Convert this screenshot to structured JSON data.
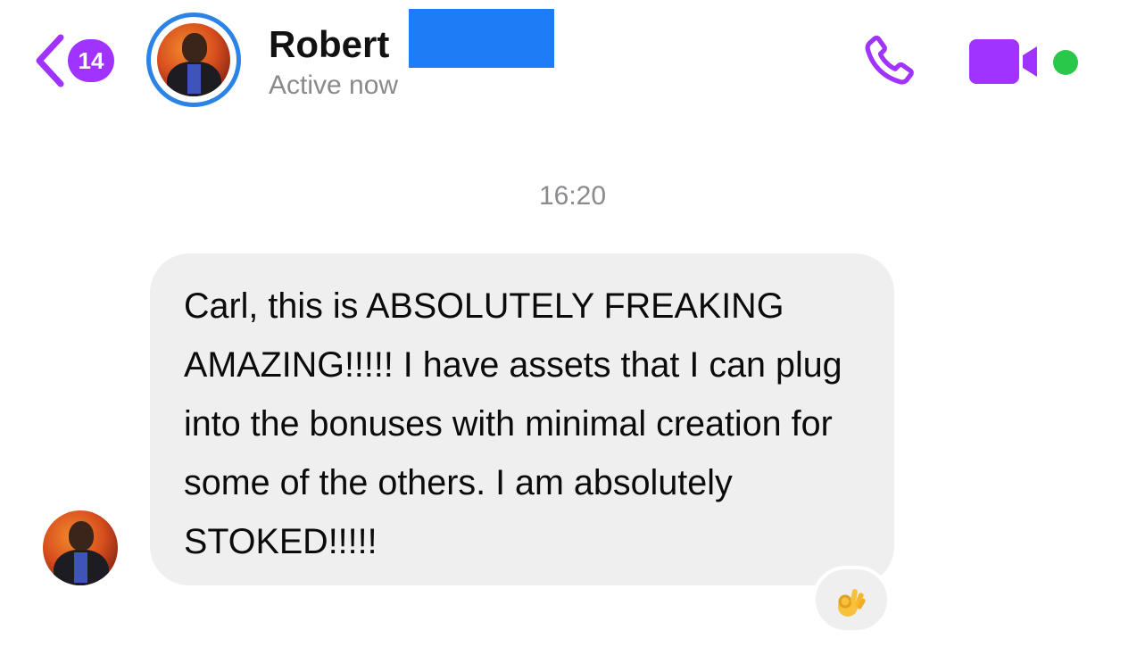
{
  "colors": {
    "accent": "#a033ff",
    "avatar_ring": "#2b83e6",
    "redaction": "#1e7cf7",
    "online": "#2ac84a",
    "bubble_bg": "#efeff0",
    "secondary_text": "#8a8a8e"
  },
  "header": {
    "back_badge_count": "14",
    "contact_name": "Robert",
    "status": "Active now",
    "icons": [
      "chevron-left-icon",
      "phone-icon",
      "video-camera-icon",
      "online-status-dot"
    ]
  },
  "conversation": {
    "timestamp": "16:20",
    "messages": [
      {
        "from": "incoming",
        "text": "Carl, this is ABSOLUTELY FREAKING AMAZING!!!!! I have assets that I can plug into the bonuses with minimal creation for some of the others. I am absolutely STOKED!!!!!",
        "reaction": "👌"
      }
    ]
  }
}
